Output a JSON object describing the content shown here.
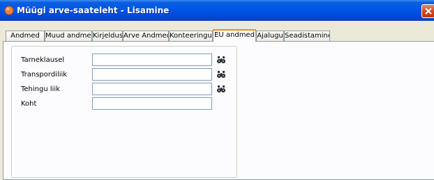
{
  "window": {
    "title": "Müügi arve-saateleht - Lisamine",
    "icon": "app-orange-icon",
    "close_icon": "close-icon"
  },
  "tabs": [
    {
      "label": "Andmed"
    },
    {
      "label": "Muud andmed"
    },
    {
      "label": "Kirjeldus"
    },
    {
      "label": "Arve Andmed"
    },
    {
      "label": "Konteeringud"
    },
    {
      "label": "EU andmed",
      "active": true
    },
    {
      "label": "Ajalugu"
    },
    {
      "label": "Seadistamine"
    }
  ],
  "form": {
    "fields": [
      {
        "label": "Tarneklausel",
        "value": "",
        "lookup_icon": "binoculars-icon"
      },
      {
        "label": "Transpordiliik",
        "value": "",
        "lookup_icon": "binoculars-icon"
      },
      {
        "label": "Tehingu liik",
        "value": "",
        "lookup_icon": "binoculars-icon"
      },
      {
        "label": "Koht",
        "value": ""
      }
    ]
  }
}
